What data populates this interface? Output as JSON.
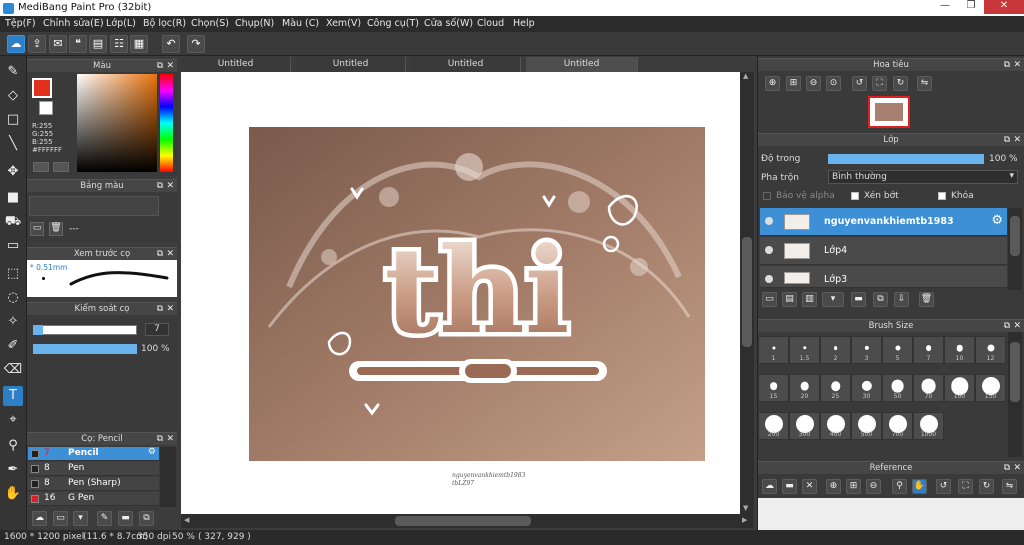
{
  "window": {
    "title": "MediBang Paint Pro (32bit)",
    "minimize": "—",
    "maximize": "❐",
    "close": "✕"
  },
  "menu": [
    "Tệp(F)",
    "Chỉnh sửa(E)",
    "Lớp(L)",
    "Bộ lọc(R)",
    "Chọn(S)",
    "Chụp(N)",
    "Màu (C)",
    "Xem(V)",
    "Công cụ(T)",
    "Cửa số(W)",
    "Cloud",
    "Help"
  ],
  "doc_tabs": [
    "Untitled",
    "Untitled",
    "Untitled",
    "Untitled"
  ],
  "color_panel": {
    "title": "Màu",
    "readout": [
      "R:255",
      "G:255",
      "B:255",
      "#FFFFFF"
    ]
  },
  "palette_panel": {
    "title": "Bảng màu",
    "dash": "---"
  },
  "brush_preview": {
    "title": "Xem trước cọ",
    "size_label": "* 0.51mm"
  },
  "brush_control": {
    "title": "Kiểm soát cọ",
    "size": "7",
    "opacity": "100 %",
    "size_fraction": 0.07,
    "opacity_fraction": 1.0
  },
  "brush_list": {
    "title": "Cọ: Pencil",
    "items": [
      {
        "size": "7",
        "name": "Pencil",
        "color": "#222222"
      },
      {
        "size": "8",
        "name": "Pen",
        "color": "#222222"
      },
      {
        "size": "8",
        "name": "Pen (Sharp)",
        "color": "#222222"
      },
      {
        "size": "16",
        "name": "G Pen",
        "color": "#e02020"
      }
    ]
  },
  "canvas": {
    "signature": "nguyenvankhiemtb1983",
    "signature2": "tbLZ97",
    "art_text": "thi"
  },
  "navigator": {
    "title": "Hoa tiêu"
  },
  "layer_panel": {
    "title": "Lớp",
    "opacity_label": "Độ trong",
    "opacity_value": "100 %",
    "opacity_fraction": 1.0,
    "blend_label": "Pha trộn",
    "blend_value": "Bình thường",
    "protect_alpha": "Bảo vệ alpha",
    "clipping": "Xén bớt",
    "lock": "Khóa",
    "layers": [
      "nguyenvankhiemtb1983",
      "Lớp4",
      "Lớp3"
    ]
  },
  "brush_size_panel": {
    "title": "Brush Size",
    "sizes": [
      "1",
      "1.5",
      "2",
      "3",
      "5",
      "7",
      "10",
      "12",
      "15",
      "20",
      "25",
      "30",
      "50",
      "70",
      "100",
      "150",
      "200",
      "300",
      "400",
      "500",
      "700",
      "1000"
    ]
  },
  "reference_panel": {
    "title": "Reference"
  },
  "status": {
    "dimensions": "1600 * 1200 pixel",
    "physical": "(11.6 * 8.7cm)",
    "dpi": "350 dpi",
    "zoom": "50 %",
    "coords": "( 327, 929 )"
  }
}
